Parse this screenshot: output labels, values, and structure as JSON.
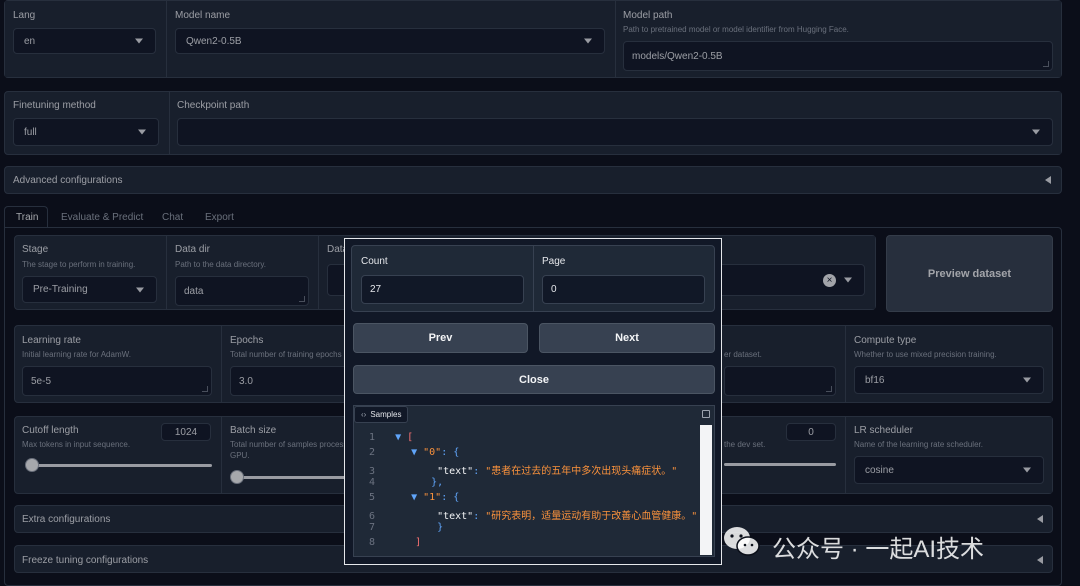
{
  "row1": {
    "lang": {
      "label": "Lang",
      "value": "en"
    },
    "model_name": {
      "label": "Model name",
      "value": "Qwen2-0.5B"
    },
    "model_path": {
      "label": "Model path",
      "info": "Path to pretrained model or model identifier from Hugging Face.",
      "value": "models/Qwen2-0.5B"
    }
  },
  "row2": {
    "finetuning": {
      "label": "Finetuning method",
      "value": "full"
    },
    "checkpoint": {
      "label": "Checkpoint path",
      "value": ""
    }
  },
  "advanced": {
    "label": "Advanced configurations"
  },
  "tabs": [
    "Train",
    "Evaluate & Predict",
    "Chat",
    "Export"
  ],
  "train": {
    "stage": {
      "label": "Stage",
      "info": "The stage to perform in training.",
      "value": "Pre-Training"
    },
    "data_dir": {
      "label": "Data dir",
      "info": "Path to the data directory.",
      "value": "data"
    },
    "dataset_label": "Data",
    "preview_button": "Preview dataset",
    "learning_rate": {
      "label": "Learning rate",
      "info": "Initial learning rate for AdamW.",
      "value": "5e-5"
    },
    "epochs": {
      "label": "Epochs",
      "info": "Total number of training epochs",
      "value": "3.0"
    },
    "hidden_info": "er dataset.",
    "compute_type": {
      "label": "Compute type",
      "info": "Whether to use mixed precision training.",
      "value": "bf16"
    },
    "cutoff": {
      "label": "Cutoff length",
      "info": "Max tokens in input sequence.",
      "value": "1024",
      "position": 0.05
    },
    "batch_size": {
      "label": "Batch size",
      "info": "Total number of samples processed c",
      "info2": "GPU.",
      "position": 0.05
    },
    "val_size": {
      "info": "the dev set.",
      "value": "0",
      "position": 1.0
    },
    "lr_scheduler": {
      "label": "LR scheduler",
      "info": "Name of the learning rate scheduler.",
      "value": "cosine"
    },
    "extra": {
      "label": "Extra configurations"
    },
    "freeze": {
      "label": "Freeze tuning configurations"
    }
  },
  "modal": {
    "count": {
      "label": "Count",
      "value": "27"
    },
    "page": {
      "label": "Page",
      "value": "0"
    },
    "prev": "Prev",
    "next": "Next",
    "close": "Close",
    "samples_label": "Samples",
    "code": {
      "line_numbers": [
        "1",
        "2",
        "3",
        "4",
        "5",
        "6",
        "7",
        "8"
      ],
      "open_bracket": "[",
      "key0": "\"0\"",
      "text_key": "\"text\"",
      "text0": "\"患者在过去的五年中多次出现头痛症状。\"",
      "key1": "\"1\"",
      "text1": "\"研究表明，适量运动有助于改善心血管健康。\"",
      "close_bracket": "]"
    }
  },
  "watermark": "公众号 · 一起AI技术"
}
